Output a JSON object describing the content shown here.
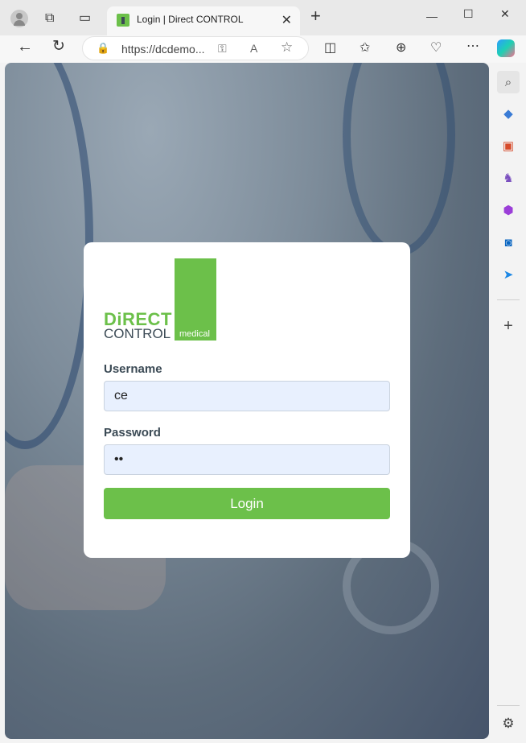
{
  "browser": {
    "tab_title": "Login | Direct CONTROL",
    "tab_close": "✕",
    "new_tab": "+",
    "url": "https://dcdemo..."
  },
  "window_controls": {
    "minimize": "—",
    "maximize": "☐",
    "close": "✕"
  },
  "login": {
    "logo_direct": "DiRECT",
    "logo_control": "CONTROL",
    "logo_medical": "medical",
    "username_label": "Username",
    "username_value": "ce",
    "password_label": "Password",
    "password_value": "ab",
    "login_button": "Login"
  },
  "colors": {
    "brand_green": "#6cc04a",
    "text_dark": "#3b4a55",
    "input_bg": "#e8f0fe"
  },
  "sidebar_icons": [
    "search-icon",
    "tag-icon",
    "toolbox-icon",
    "chess-icon",
    "office-icon",
    "outlook-icon",
    "telegram-icon",
    "add-icon",
    "settings-icon"
  ]
}
